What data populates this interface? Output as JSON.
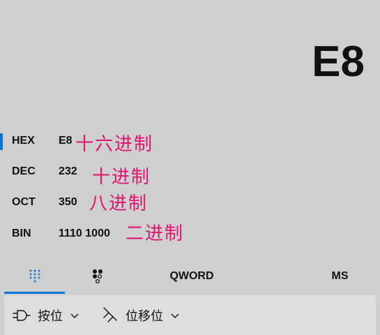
{
  "display": {
    "value": "E8"
  },
  "radix": [
    {
      "label": "HEX",
      "value": "E8",
      "annotation": "十六进制",
      "selected": true
    },
    {
      "label": "DEC",
      "value": "232",
      "annotation": "十进制",
      "selected": false
    },
    {
      "label": "OCT",
      "value": "350",
      "annotation": "八进制",
      "selected": false
    },
    {
      "label": "BIN",
      "value": "1110 1000",
      "annotation": "二进制",
      "selected": false
    }
  ],
  "modes": {
    "keypad_icon": "full-keypad-icon",
    "bit_toggle_icon": "bit-toggling-keypad-icon",
    "word_size": "QWORD",
    "memory_store": "MS"
  },
  "toolbar": {
    "bitwise_label": "按位",
    "bitshift_label": "位移位",
    "bitwise_icon": "logic-gate-icon",
    "bitshift_icon": "bit-shift-icon"
  },
  "colors": {
    "accent": "#0a72d9",
    "annotation": "#e0146e",
    "background": "#cfcfcf",
    "toolbar_bg": "#dedede"
  }
}
